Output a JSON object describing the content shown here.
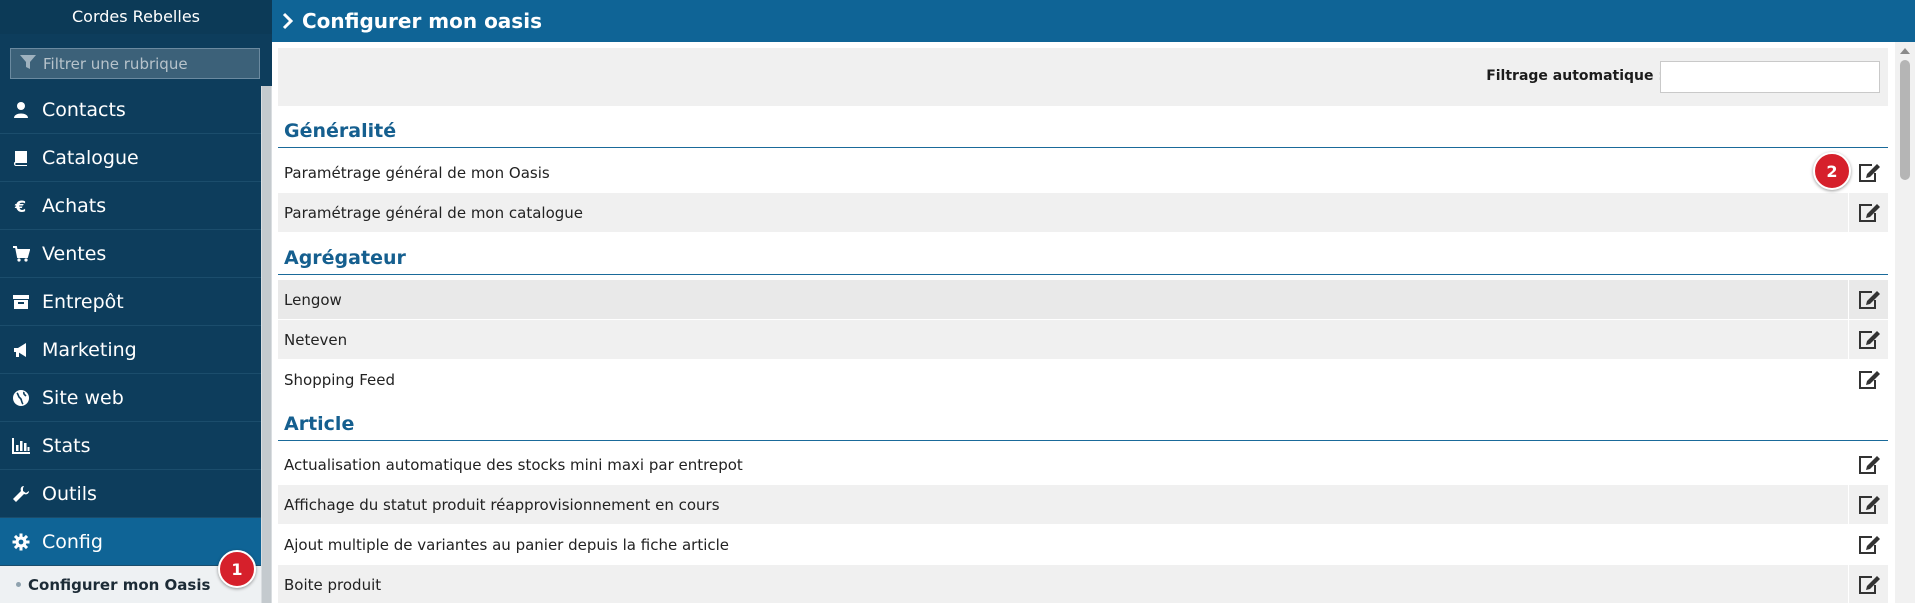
{
  "app": {
    "title": "Cordes Rebelles"
  },
  "sidebar": {
    "filter_placeholder": "Filtrer une rubrique",
    "items": [
      {
        "label": "Contacts",
        "icon": "user-icon"
      },
      {
        "label": "Catalogue",
        "icon": "book-icon"
      },
      {
        "label": "Achats",
        "icon": "euro-icon"
      },
      {
        "label": "Ventes",
        "icon": "cart-icon"
      },
      {
        "label": "Entrepôt",
        "icon": "archive-icon"
      },
      {
        "label": "Marketing",
        "icon": "megaphone-icon"
      },
      {
        "label": "Site web",
        "icon": "globe-icon"
      },
      {
        "label": "Stats",
        "icon": "bar-chart-icon"
      },
      {
        "label": "Outils",
        "icon": "wrench-icon"
      },
      {
        "label": "Config",
        "icon": "gear-icon",
        "active": true
      }
    ],
    "sub_item": "Configurer mon Oasis",
    "badge": "1"
  },
  "header": {
    "title": "Configurer mon oasis"
  },
  "filter": {
    "label": "Filtrage automatique :",
    "value": ""
  },
  "sections": [
    {
      "title": "Généralité",
      "rows": [
        "Paramétrage général de mon Oasis",
        "Paramétrage général de mon catalogue"
      ]
    },
    {
      "title": "Agrégateur",
      "rows": [
        "Lengow",
        "Neteven",
        "Shopping Feed"
      ]
    },
    {
      "title": "Article",
      "rows": [
        "Actualisation automatique des stocks mini maxi par entrepot",
        "Affichage du statut produit réapprovisionnement en cours",
        "Ajout multiple de variantes au panier depuis la fiche article",
        "Boite produit"
      ]
    }
  ],
  "badge2": "2",
  "colors": {
    "sidebar_bg": "#0d3d5c",
    "accent": "#0f6496",
    "section_title": "#155f8f",
    "badge": "#d6202b"
  }
}
